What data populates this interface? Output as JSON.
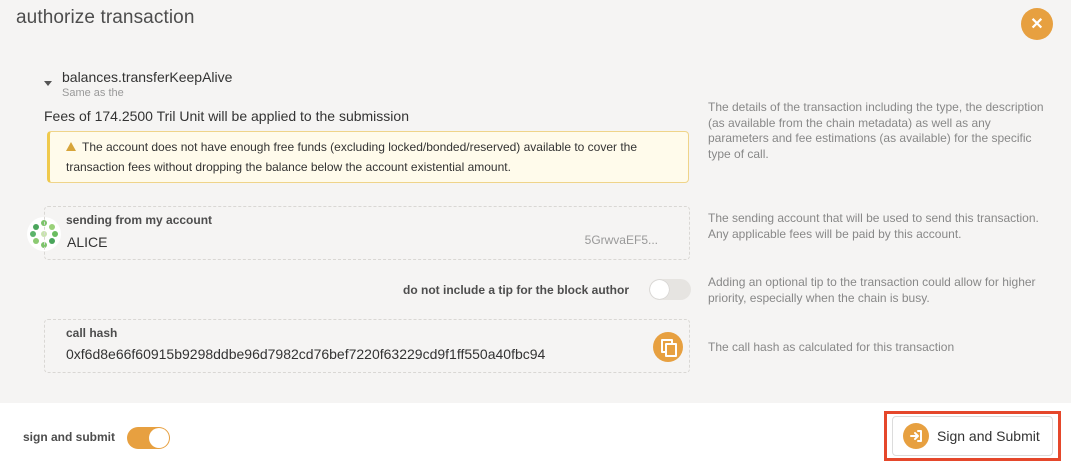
{
  "modal": {
    "title": "authorize transaction",
    "close_icon": "x-icon"
  },
  "call": {
    "method": "balances.transferKeepAlive",
    "description": "Same as the",
    "fees_text": "Fees of 174.2500 Tril Unit will be applied to the submission",
    "warning_text": "The account does not have enough free funds (excluding locked/bonded/reserved) available to cover the transaction fees without dropping the balance below the account existential amount.",
    "help_text": "The details of the transaction including the type, the description (as available from the chain metadata) as well as any parameters and fee estimations (as available) for the specific type of call."
  },
  "account": {
    "label": "sending from my account",
    "name": "ALICE",
    "address": "5GrwvaEF5...",
    "help_text": "The sending account that will be used to send this transaction. Any applicable fees will be paid by this account."
  },
  "tip": {
    "label": "do not include a tip for the block author",
    "enabled": false,
    "help_text": "Adding an optional tip to the transaction could allow for higher priority, especially when the chain is busy."
  },
  "call_hash": {
    "label": "call hash",
    "value": "0xf6d8e66f60915b9298ddbe96d7982cd76bef7220f63229cd9f1ff550a40fbc94",
    "help_text": "The call hash as calculated for this transaction"
  },
  "footer": {
    "toggle_label": "sign and submit",
    "toggle_on": true,
    "submit_label": "Sign and Submit"
  },
  "colors": {
    "accent": "#e7a040",
    "highlight": "#e5472b",
    "warning_bg": "#fffbeb"
  }
}
